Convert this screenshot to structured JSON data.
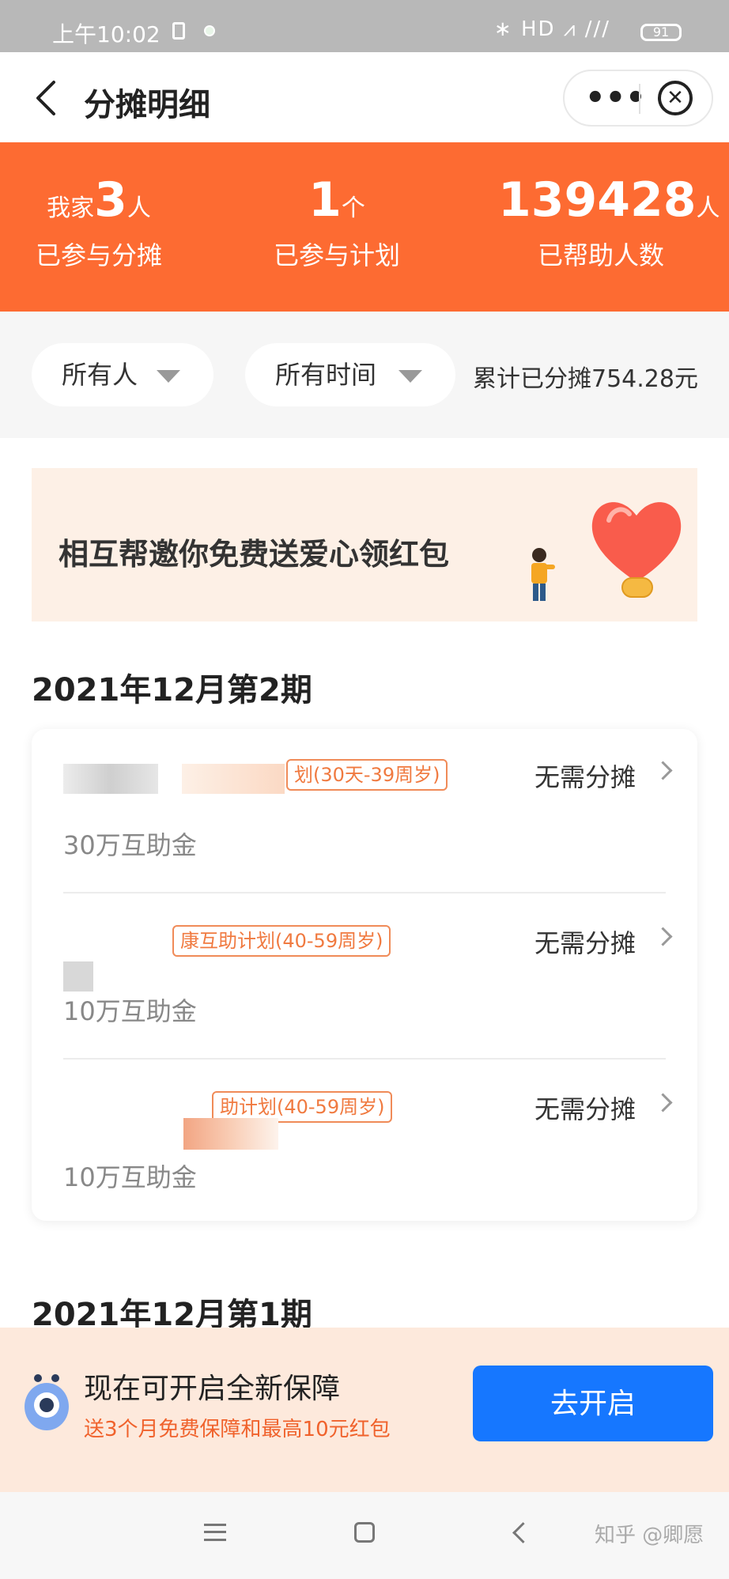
{
  "status_bar": {
    "time": "上午10:02",
    "network_icons": "∗ HD ⩘ /// ",
    "battery": "91"
  },
  "nav": {
    "title": "分摊明细"
  },
  "summary": {
    "family": {
      "prefix": "我家",
      "value": "3",
      "unit": "人",
      "label": "已参与分摊"
    },
    "plans": {
      "value": "1",
      "unit": "个",
      "label": "已参与计划"
    },
    "helped": {
      "value": "139428",
      "unit": "人",
      "label": "已帮助人数"
    }
  },
  "filters": {
    "person": "所有人",
    "time": "所有时间",
    "cumulative": "累计已分摊754.28元"
  },
  "banner": {
    "text": "相互帮邀你免费送爱心领红包"
  },
  "periods": [
    {
      "title": "2021年12月第2期",
      "items": [
        {
          "plan_tag": "划(30天-39周岁)",
          "status": "无需分摊",
          "amount": "30万互助金"
        },
        {
          "plan_tag": "康互助计划(40-59周岁)",
          "status": "无需分摊",
          "amount": "10万互助金"
        },
        {
          "plan_tag": "助计划(40-59周岁)",
          "status": "无需分摊",
          "amount": "10万互助金"
        }
      ]
    },
    {
      "title": "2021年12月第1期"
    }
  ],
  "promo": {
    "title": "现在可开启全新保障",
    "subtitle": "送3个月免费保障和最高10元红包",
    "button": "去开启"
  },
  "watermark": "知乎 @卿愿",
  "colors": {
    "orange": "#fd6b32",
    "blue": "#1677ff",
    "tag": "#f07a40"
  }
}
